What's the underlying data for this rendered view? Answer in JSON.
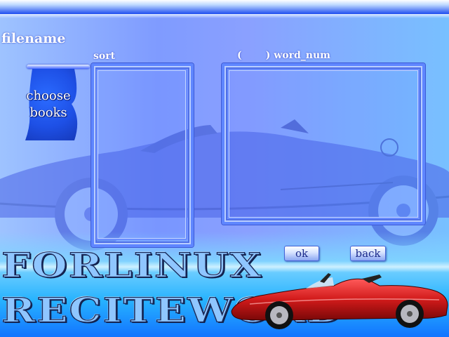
{
  "labels": {
    "filename": "filename",
    "sort": "sort",
    "word_num": "(       ) word_num"
  },
  "choose_books": {
    "line1": "choose",
    "line2": "books"
  },
  "buttons": {
    "ok": "ok",
    "back": "back"
  },
  "title": {
    "line1": "FORLINUX",
    "line2": "RECITEWORD"
  },
  "sort_list": {
    "items": []
  },
  "word_list": {
    "items": []
  },
  "colors": {
    "background": "#8aa0ff",
    "accent_blue": "#1e50e6",
    "listbox_border": "#5f86ff",
    "car_red": "#d11a1a"
  },
  "icons": {
    "background_car": "convertible-car-illustration",
    "foreground_car": "red-convertible-car-image"
  }
}
